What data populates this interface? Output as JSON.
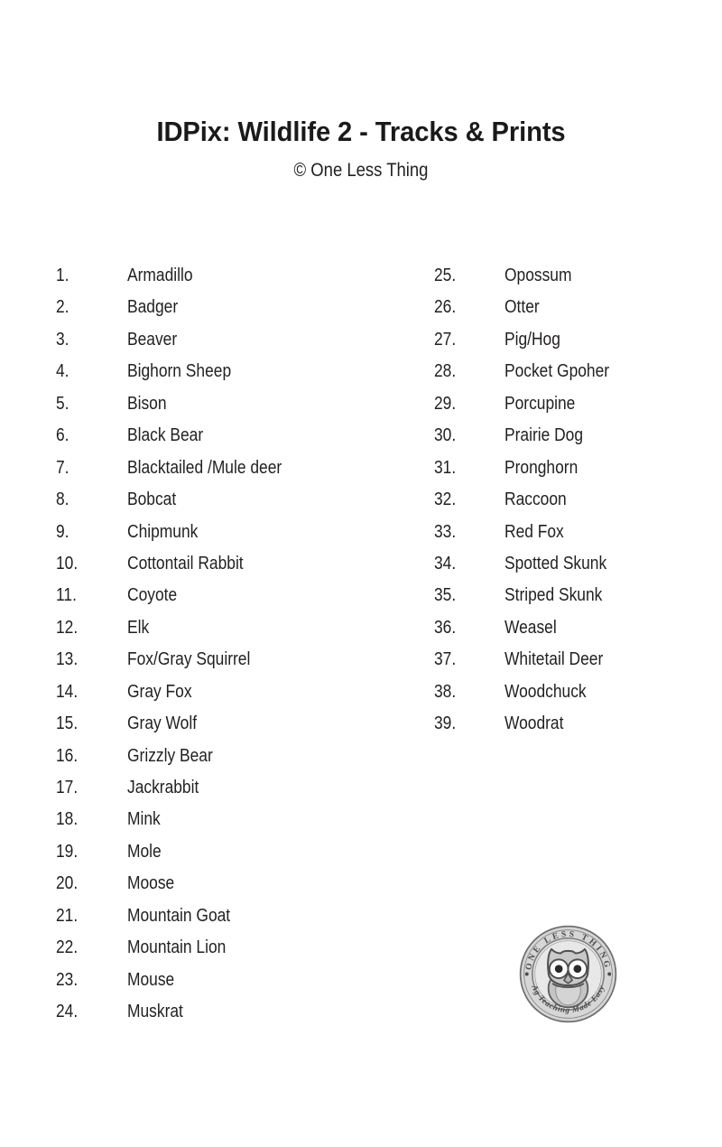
{
  "document": {
    "title": "IDPix: Wildlife 2 - Tracks & Prints",
    "subtitle": "© One Less Thing",
    "background_color": "#ffffff",
    "text_color": "#231f20"
  },
  "species_list": {
    "total_count": 39,
    "left_column": [
      {
        "number": "1.",
        "name": "Armadillo"
      },
      {
        "number": "2.",
        "name": "Badger"
      },
      {
        "number": "3.",
        "name": "Beaver"
      },
      {
        "number": "4.",
        "name": "Bighorn Sheep"
      },
      {
        "number": "5.",
        "name": "Bison"
      },
      {
        "number": "6.",
        "name": "Black Bear"
      },
      {
        "number": "7.",
        "name": "Blacktailed /Mule deer"
      },
      {
        "number": "8.",
        "name": "Bobcat"
      },
      {
        "number": "9.",
        "name": "Chipmunk"
      },
      {
        "number": "10.",
        "name": "Cottontail Rabbit"
      },
      {
        "number": "11.",
        "name": "Coyote"
      },
      {
        "number": "12.",
        "name": "Elk"
      },
      {
        "number": "13.",
        "name": "Fox/Gray Squirrel"
      },
      {
        "number": "14.",
        "name": "Gray Fox"
      },
      {
        "number": "15.",
        "name": "Gray Wolf"
      },
      {
        "number": "16.",
        "name": "Grizzly Bear"
      },
      {
        "number": "17.",
        "name": "Jackrabbit"
      },
      {
        "number": "18.",
        "name": "Mink"
      },
      {
        "number": "19.",
        "name": "Mole"
      },
      {
        "number": "20.",
        "name": "Moose"
      },
      {
        "number": "21.",
        "name": "Mountain Goat"
      },
      {
        "number": "22.",
        "name": "Mountain Lion"
      },
      {
        "number": "23.",
        "name": "Mouse"
      },
      {
        "number": "24.",
        "name": "Muskrat"
      }
    ],
    "right_column": [
      {
        "number": "25.",
        "name": "Opossum"
      },
      {
        "number": "26.",
        "name": "Otter"
      },
      {
        "number": "27.",
        "name": "Pig/Hog"
      },
      {
        "number": "28.",
        "name": "Pocket Gpoher"
      },
      {
        "number": "29.",
        "name": "Porcupine"
      },
      {
        "number": "30.",
        "name": "Prairie Dog"
      },
      {
        "number": "31.",
        "name": "Pronghorn"
      },
      {
        "number": "32.",
        "name": "Raccoon"
      },
      {
        "number": "33.",
        "name": "Red Fox"
      },
      {
        "number": "34.",
        "name": "Spotted Skunk"
      },
      {
        "number": "35.",
        "name": "Striped Skunk"
      },
      {
        "number": "36.",
        "name": "Weasel"
      },
      {
        "number": "37.",
        "name": "Whitetail Deer"
      },
      {
        "number": "38.",
        "name": "Woodchuck"
      },
      {
        "number": "39.",
        "name": "Woodrat"
      }
    ]
  },
  "logo": {
    "icon": "owl-logo",
    "top_arc_text": "ONE LESS THING",
    "bottom_arc_text": "Ag Teaching Made Easy",
    "ring_fill": "#d6d6d6",
    "ring_stroke": "#6b6b6b",
    "owl_body": "#bdbdbd",
    "owl_outline": "#4d4d4d"
  }
}
